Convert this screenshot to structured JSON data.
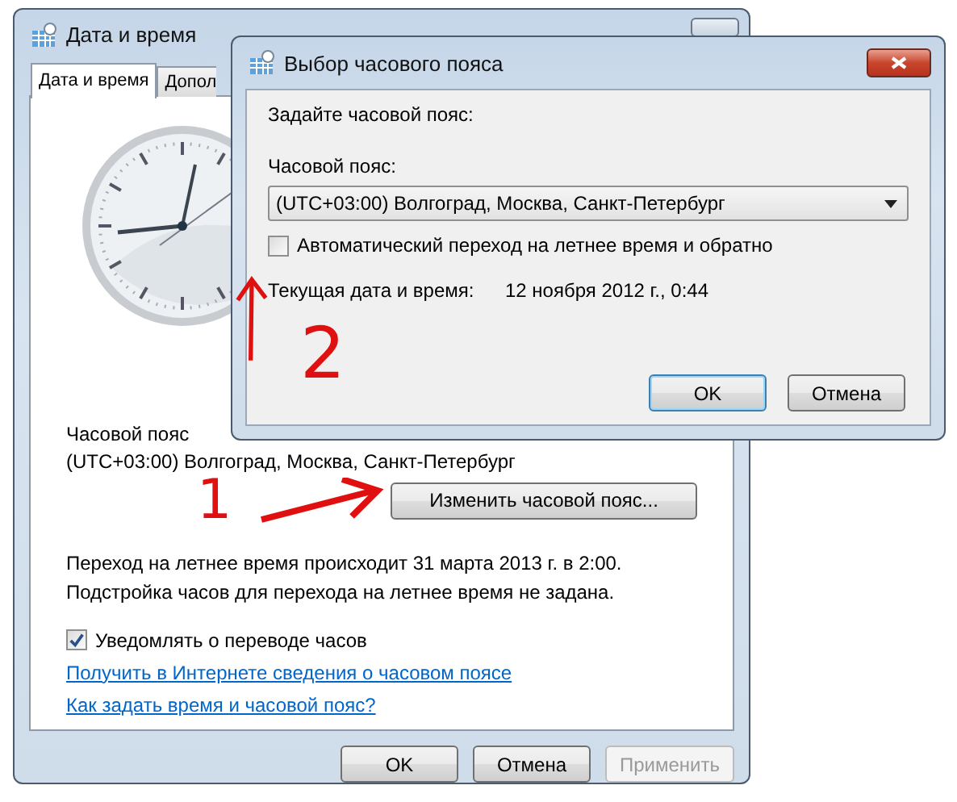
{
  "main_window": {
    "title": "Дата и время",
    "tabs": [
      {
        "label": "Дата и время",
        "selected": true
      },
      {
        "label": "Допол",
        "selected": false
      }
    ],
    "timezone_heading": "Часовой пояс",
    "timezone_value": "(UTC+03:00) Волгоград, Москва, Санкт-Петербург",
    "change_button": "Изменить часовой пояс...",
    "dst_notes": [
      "Переход на летнее время происходит 31 марта 2013 г. в 2:00.",
      "Подстройка часов для перехода на летнее время не задана."
    ],
    "notify_checkbox": {
      "label": "Уведомлять о переводе часов",
      "checked": true
    },
    "links": [
      "Получить в Интернете сведения о часовом поясе",
      "Как задать время и часовой пояс?"
    ],
    "buttons": [
      {
        "label": "OK",
        "disabled": false
      },
      {
        "label": "Отмена",
        "disabled": false
      },
      {
        "label": "Применить",
        "disabled": true
      }
    ]
  },
  "dialog": {
    "title": "Выбор часового пояса",
    "prompt": "Задайте часовой пояс:",
    "timezone_label": "Часовой пояс:",
    "timezone_select": "(UTC+03:00) Волгоград, Москва, Санкт-Петербург",
    "auto_dst": {
      "label": "Автоматический переход на летнее время и обратно",
      "checked": false
    },
    "current_label": "Текущая дата и время:",
    "current_value": "12 ноября 2012 г., 0:44",
    "buttons": [
      {
        "label": "OK",
        "default": true
      },
      {
        "label": "Отмена",
        "default": false
      }
    ]
  },
  "annotations": [
    {
      "text": "1"
    },
    {
      "text": "2"
    }
  ]
}
